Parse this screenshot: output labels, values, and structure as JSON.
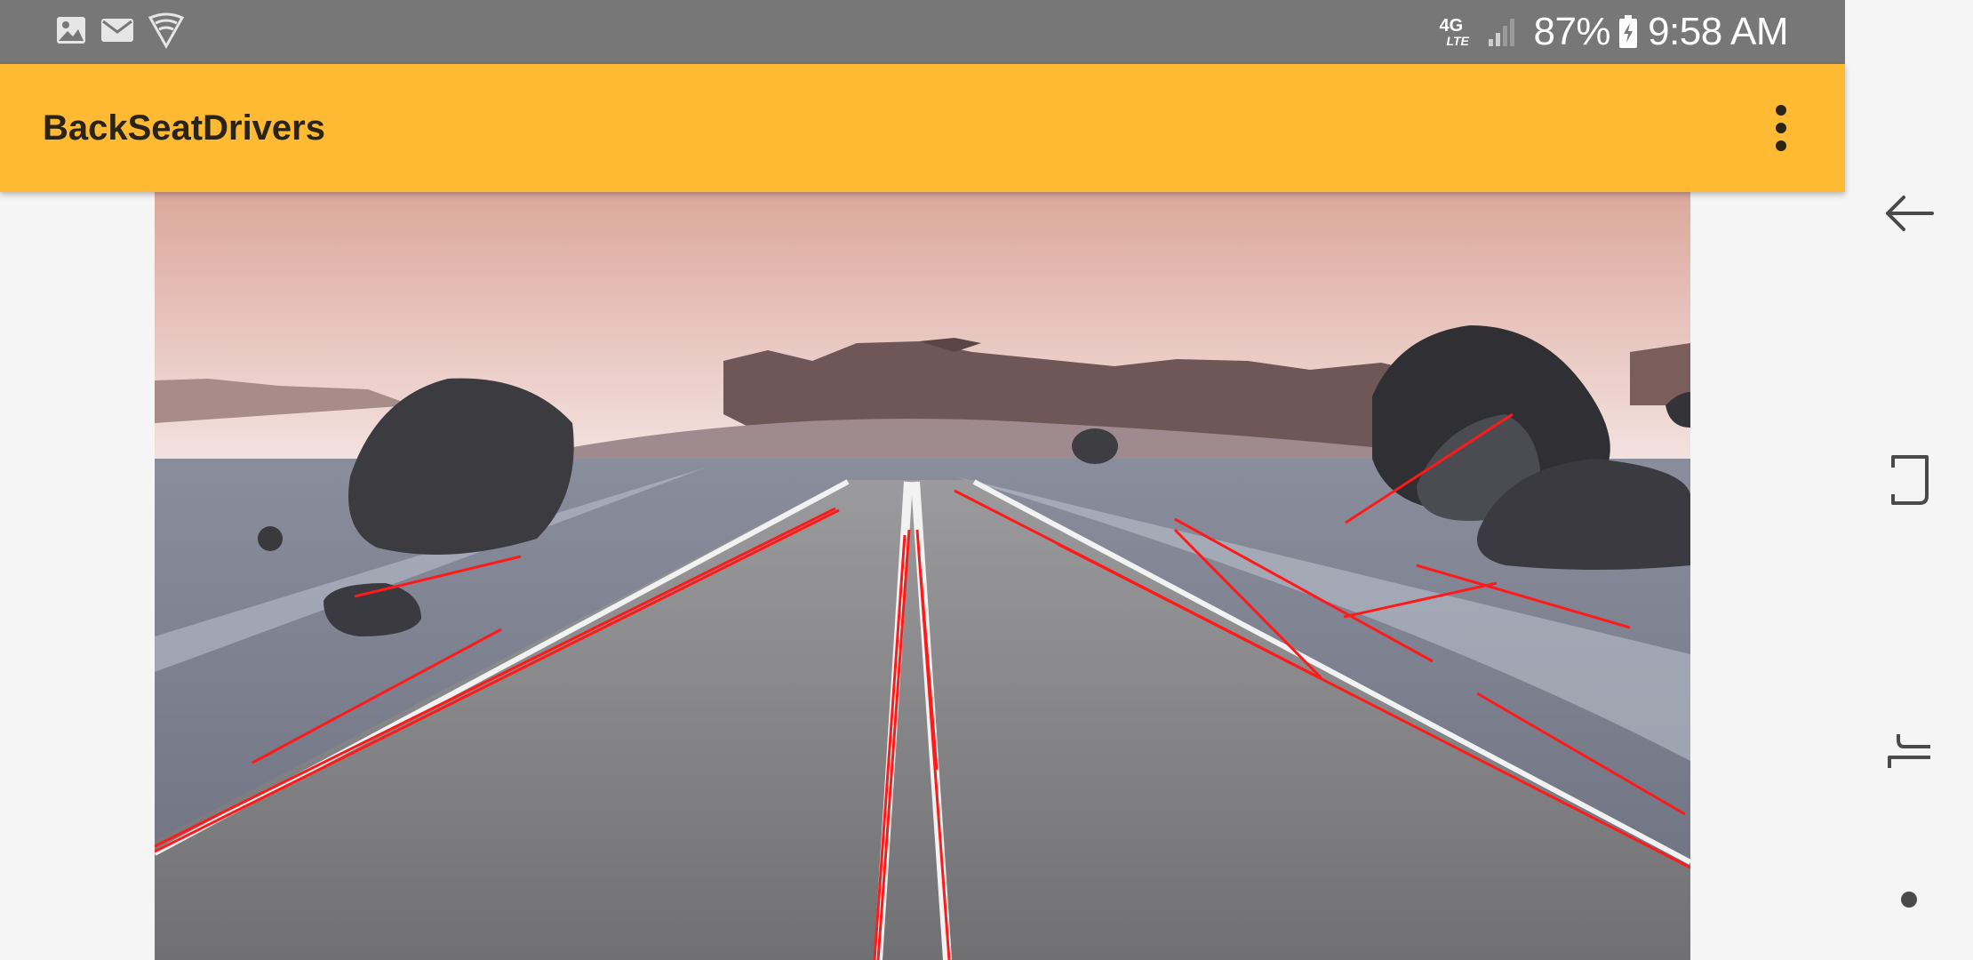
{
  "status_bar": {
    "left_icons": [
      "gallery-icon",
      "mail-icon",
      "wifi-icon"
    ],
    "network_label": "4G",
    "network_sublabel": "LTE",
    "battery_percent": "87%",
    "time": "9:58 AM",
    "background": "#777777"
  },
  "toolbar": {
    "title": "BackSeatDrivers",
    "background": "#ffba33",
    "menu_icon": "more-vert-icon"
  },
  "main": {
    "image_subject": "road-with-lane-detection",
    "lane_line_color": "#ff1a1a"
  },
  "nav_bar": {
    "buttons": [
      "back-icon",
      "recents-icon",
      "overview-icon",
      "home-dot-icon"
    ]
  }
}
